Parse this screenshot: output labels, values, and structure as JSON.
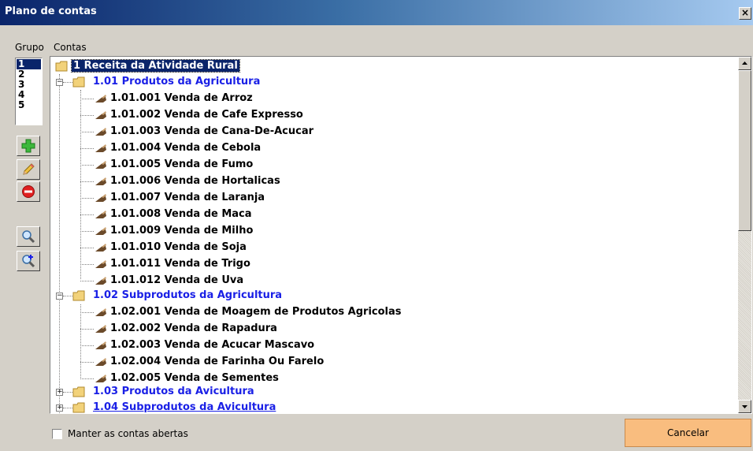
{
  "window": {
    "title": "Plano de contas",
    "close_label": "×"
  },
  "headers": {
    "grupo": "Grupo",
    "contas": "Contas"
  },
  "grupos": [
    "1",
    "2",
    "3",
    "4",
    "5"
  ],
  "toolbar": {
    "add_icon": "plus-icon",
    "edit_icon": "pencil-icon",
    "delete_icon": "delete-icon",
    "search_icon": "magnifier-icon",
    "zoom_icon": "magnifier-plus-icon"
  },
  "tree": {
    "root": "1 Receita da Atividade Rural",
    "groups": [
      {
        "label": "1.01 Produtos da Agricultura",
        "expanded": true,
        "items": [
          "1.01.001 Venda de Arroz",
          "1.01.002 Venda de Cafe Expresso",
          "1.01.003 Venda de Cana-De-Acucar",
          "1.01.004 Venda de Cebola",
          "1.01.005 Venda de Fumo",
          "1.01.006 Venda de Hortalicas",
          "1.01.007 Venda de Laranja",
          "1.01.008 Venda de Maca",
          "1.01.009 Venda de Milho",
          "1.01.010 Venda de Soja",
          "1.01.011 Venda de Trigo",
          "1.01.012 Venda de Uva"
        ]
      },
      {
        "label": "1.02 Subprodutos da Agricultura",
        "expanded": true,
        "items": [
          "1.02.001 Venda de Moagem de Produtos Agricolas",
          "1.02.002 Venda de Rapadura",
          "1.02.003 Venda de Acucar Mascavo",
          "1.02.004 Venda de Farinha Ou Farelo",
          "1.02.005 Venda de Sementes"
        ]
      },
      {
        "label": "1.03 Produtos da Avicultura",
        "expanded": false,
        "items": []
      },
      {
        "label": "1.04 Subprodutos da Avicultura",
        "expanded": false,
        "items": []
      }
    ]
  },
  "footer": {
    "keep_open_label": "Manter as contas abertas",
    "keep_open_checked": false,
    "cancel_label": "Cancelar"
  },
  "colors": {
    "group_label": "#1a20e6",
    "selection": "#0a246a",
    "cancel_button": "#f9bd7f"
  }
}
